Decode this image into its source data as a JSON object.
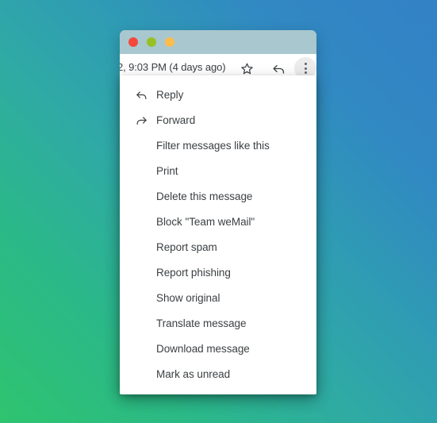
{
  "window": {
    "traffic_lights": [
      {
        "name": "close",
        "color": "#f4483f"
      },
      {
        "name": "minimize",
        "color": "#97c024"
      },
      {
        "name": "zoom",
        "color": "#fcbd4e"
      }
    ],
    "title_bar_color": "#a9c7ce"
  },
  "toolbar": {
    "timestamp": "2, 9:03 PM (4 days ago)",
    "star_icon": "star-outline-icon",
    "reply_icon": "reply-arrow-icon",
    "more_icon": "more-vertical-icon"
  },
  "menu": {
    "items": [
      {
        "label": "Reply",
        "icon": "reply-arrow-icon"
      },
      {
        "label": "Forward",
        "icon": "forward-arrow-icon"
      },
      {
        "label": "Filter messages like this",
        "icon": null
      },
      {
        "label": "Print",
        "icon": null
      },
      {
        "label": "Delete this message",
        "icon": null
      },
      {
        "label": "Block \"Team weMail\"",
        "icon": null
      },
      {
        "label": "Report spam",
        "icon": null
      },
      {
        "label": "Report phishing",
        "icon": null
      },
      {
        "label": "Show original",
        "icon": null
      },
      {
        "label": "Translate message",
        "icon": null
      },
      {
        "label": "Download message",
        "icon": null
      },
      {
        "label": "Mark as unread",
        "icon": null
      }
    ]
  },
  "background": {
    "gradient_from": "#2ec46f",
    "gradient_to": "#3381c6"
  }
}
